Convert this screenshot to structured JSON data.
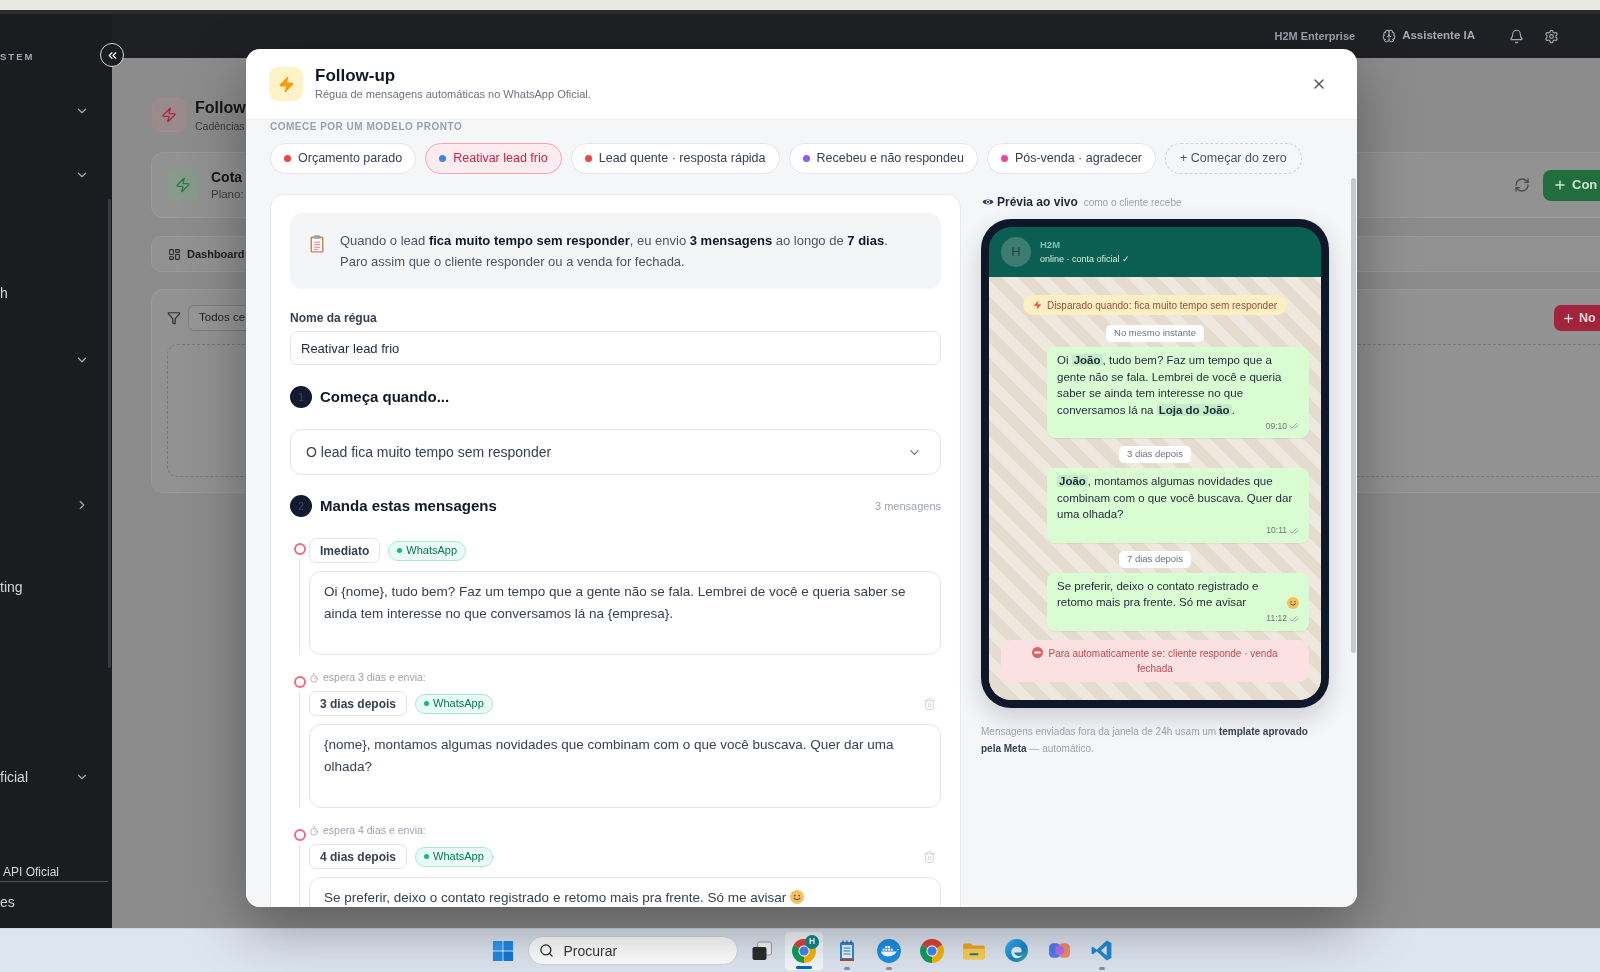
{
  "topbar": {
    "workspace": "H2M Enterprise",
    "assistant": "Assistente IA"
  },
  "sidebar": {
    "section_label": "STEM",
    "items": [
      {
        "kind": "group"
      },
      {
        "kind": "group"
      },
      {
        "kind": "item",
        "label": "h"
      },
      {
        "kind": "group"
      },
      {
        "kind": "submenu"
      },
      {
        "kind": "item",
        "label": "ting"
      },
      {
        "kind": "group",
        "label": "ficial"
      },
      {
        "kind": "subitem",
        "label": "API Oficial"
      },
      {
        "kind": "item",
        "label": "es"
      }
    ]
  },
  "background_page": {
    "title": "Follow",
    "subtitle": "Cadências",
    "quota_card": {
      "title": "Cota",
      "plan": "Plano:",
      "button": "Con"
    },
    "tabs": [
      {
        "label": "Dashboard"
      }
    ],
    "filter": {
      "value": "Todos ce"
    },
    "add_button": "No"
  },
  "modal": {
    "title": "Follow-up",
    "subtitle": "Régua de mensagens automáticas no WhatsApp Oficial.",
    "templates": {
      "label": "COMECE POR UM MODELO PRONTO",
      "items": [
        {
          "label": "Orçamento parado",
          "color": "#ef4444",
          "selected": false
        },
        {
          "label": "Reativar lead frio",
          "color": "#3b82f6",
          "selected": true
        },
        {
          "label": "Lead quente · resposta rápida",
          "color": "#ef4444",
          "selected": false
        },
        {
          "label": "Recebeu e não respondeu",
          "color": "#8b5cf6",
          "selected": false
        },
        {
          "label": "Pós-venda · agradecer",
          "color": "#ec4899",
          "selected": false
        }
      ],
      "start_blank": "+ Começar do zero"
    },
    "summary": "Quando o lead **fica muito tempo sem responder**, eu envio **3 mensagens** ao longo de **7 dias**.",
    "summary_note": "Paro assim que o cliente responder ou a venda for fechada.",
    "name_field": {
      "label": "Nome da régua",
      "value": "Reativar lead frio"
    },
    "trigger_step": {
      "number": "1",
      "title": "Começa quando...",
      "value": "O lead fica muito tempo sem responder"
    },
    "messages_step": {
      "number": "2",
      "title": "Manda estas mensagens",
      "count": "3 mensagens",
      "messages": [
        {
          "delay": "Imediato",
          "channel": "WhatsApp",
          "text": "Oi {nome}, tudo bem? Faz um tempo que a gente não se fala. Lembrei de você e queria saber se ainda tem interesse no que conversamos lá na {empresa}.",
          "emoji": false,
          "deletable": false
        },
        {
          "wait": "espera 3 dias e envia:",
          "delay": "3 dias depois",
          "channel": "WhatsApp",
          "text": "{nome}, montamos algumas novidades que combinam com o que você buscava. Quer dar uma olhada?",
          "emoji": false,
          "deletable": true
        },
        {
          "wait": "espera 4 dias e envia:",
          "delay": "4 dias depois",
          "channel": "WhatsApp",
          "text": "Se preferir, deixo o contato registrado e retomo mais pra frente. Só me avisar",
          "emoji": true,
          "deletable": true
        }
      ]
    },
    "preview": {
      "title": "Prévia ao vivo",
      "hint": "como o cliente recebe",
      "contact": {
        "initial": "H",
        "name": "H2M",
        "status": "online · conta oficial ✓"
      },
      "trigger_note": "Disparado quando: fica muito tempo sem responder",
      "chat": [
        {
          "kind": "divider",
          "text": "No mesmo instante"
        },
        {
          "kind": "message",
          "text": "Oi **João**, tudo bem? Faz um tempo que a gente não se fala. Lembrei de você e queria saber se ainda tem interesse no que conversamos lá na **Loja do João**.",
          "time": "09:10",
          "emoji": false
        },
        {
          "kind": "divider",
          "text": "3 dias depois"
        },
        {
          "kind": "message",
          "text": "**João**, montamos algumas novidades que combinam com o que você buscava. Quer dar uma olhada?",
          "time": "10:11",
          "emoji": false
        },
        {
          "kind": "divider",
          "text": "7 dias depois"
        },
        {
          "kind": "message",
          "text": "Se preferir, deixo o contato registrado e retomo mais pra frente. Só me avisar",
          "time": "11:12",
          "emoji": true
        }
      ],
      "stop_note": "Para automaticamente se: cliente responde · venda fechada",
      "footnote": "Mensagens enviadas fora da janela de 24h usam um **template aprovado pela Meta** — automático."
    }
  },
  "taskbar": {
    "search_placeholder": "Procurar",
    "apps": [
      {
        "kind": "taskview",
        "selected": false,
        "running": false
      },
      {
        "kind": "chrome",
        "selected": true,
        "running": true,
        "badge": "H"
      },
      {
        "kind": "notepad",
        "selected": false,
        "running": true
      },
      {
        "kind": "docker",
        "selected": false,
        "running": true
      },
      {
        "kind": "chrome",
        "selected": false,
        "running": false
      },
      {
        "kind": "folder",
        "selected": false,
        "running": false
      },
      {
        "kind": "edge",
        "selected": false,
        "running": false
      },
      {
        "kind": "copilot",
        "selected": false,
        "running": false
      },
      {
        "kind": "vscode",
        "selected": false,
        "running": true
      }
    ]
  }
}
